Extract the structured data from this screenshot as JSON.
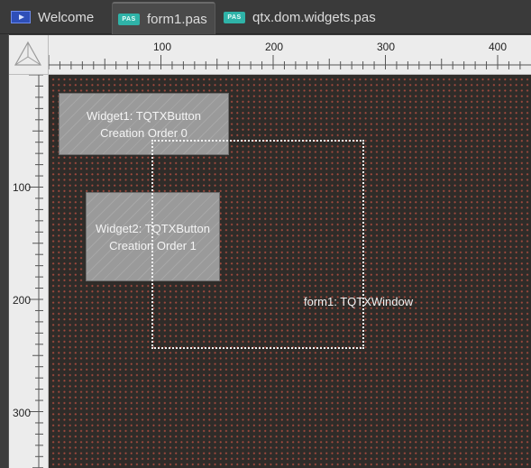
{
  "tabs": [
    {
      "label": "Welcome",
      "icon": "welcome-icon",
      "active": false
    },
    {
      "label": "form1.pas",
      "icon": "pas-file-icon",
      "badge": "PAS",
      "active": true
    },
    {
      "label": "qtx.dom.widgets.pas",
      "icon": "pas-file-icon",
      "badge": "PAS",
      "active": false
    }
  ],
  "ruler": {
    "horizontal_labels": [
      "100",
      "200",
      "300",
      "400"
    ],
    "vertical_labels": [
      "100",
      "200",
      "300"
    ]
  },
  "designer": {
    "widgets": [
      {
        "line1": "Widget1: TQTXButton",
        "line2": "Creation Order 0"
      },
      {
        "line1": "Widget2: TQTXButton",
        "line2": "Creation Order 1"
      }
    ],
    "form_label": "form1: TQTXWindow"
  },
  "colors": {
    "canvas_bg": "#2f2c29",
    "grid_dot": "#a24a3e",
    "widget_fill": "#9a9a9a",
    "pas_badge": "#2fb3a8",
    "welcome_badge": "#2e4fb8"
  }
}
